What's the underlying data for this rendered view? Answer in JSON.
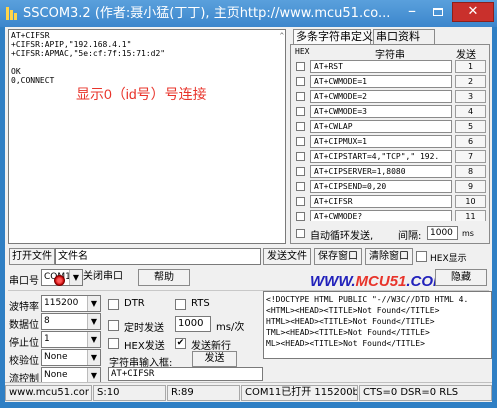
{
  "window": {
    "title": "SSCOM3.2 (作者:聂小猛(丁丁), 主页http://www.mcu51.co...",
    "minimize_label": "–",
    "close_label": "✕",
    "accent": "#3c86cc",
    "close_color": "#c9302c"
  },
  "receive": {
    "lines": [
      "AT+CIFSR",
      "+CIFSR:APIP,\"192.168.4.1\"",
      "+CIFSR:APMAC,\"5e:cf:7f:15:71:d2\"",
      "",
      "OK",
      "0,CONNECT"
    ],
    "annotation": "显示0（id号）号连接",
    "annotation_color": "#e8342b"
  },
  "multi": {
    "tab1": "多条字符串定义",
    "tab2": "串口资料",
    "col_hex": "HEX",
    "col_str": "字符串",
    "col_send": "发送",
    "rows": [
      {
        "cmd": "AT+RST",
        "send": "1"
      },
      {
        "cmd": "AT+CWMODE=1",
        "send": "2"
      },
      {
        "cmd": "AT+CWMODE=2",
        "send": "3"
      },
      {
        "cmd": "AT+CWMODE=3",
        "send": "4"
      },
      {
        "cmd": "AT+CWLAP",
        "send": "5"
      },
      {
        "cmd": "AT+CIPMUX=1",
        "send": "6"
      },
      {
        "cmd": " AT+CIPSTART=4,\"TCP\",\" 192.",
        "send": "7"
      },
      {
        "cmd": "AT+CIPSERVER=1,8080",
        "send": "8"
      },
      {
        "cmd": "AT+CIPSEND=0,20",
        "send": "9"
      },
      {
        "cmd": "AT+CIFSR",
        "send": "10"
      },
      {
        "cmd": "AT+CWMODE?",
        "send": "11"
      }
    ],
    "loop_label": "自动循环发送,",
    "interval_label": "间隔:",
    "interval_value": "1000",
    "interval_unit": "ms"
  },
  "row1": {
    "open_file": "打开文件",
    "file_name": "文件名",
    "send_file": "发送文件",
    "save_window": "保存窗口",
    "clear_window": "清除窗口",
    "hex_display": "HEX显示"
  },
  "row2": {
    "port_label": "串口号",
    "port_value": "COM11",
    "close_port": "关闭串口",
    "help": "帮助",
    "brand_a": "WWW.",
    "brand_b": "MCU51",
    "brand_c": ".COM",
    "hide": "隐藏"
  },
  "settings": {
    "baud_label": "波特率",
    "baud_value": "115200",
    "data_label": "数据位",
    "data_value": "8",
    "stop_label": "停止位",
    "stop_value": "1",
    "parity_label": "校验位",
    "parity_value": "None",
    "flow_label": "流控制",
    "flow_value": "None",
    "dtr": "DTR",
    "rts": "RTS",
    "timed_send": "定时发送",
    "timed_value": "1000",
    "timed_unit": "ms/次",
    "hex_send": "HEX发送",
    "send_newline": "发送新行",
    "input_label": "字符串输入框:",
    "send_button": "发送",
    "input_value": "AT+CIFSR"
  },
  "sendbox": {
    "lines": [
      "<!DOCTYPE HTML PUBLIC \"-//W3C//DTD HTML 4.",
      "<HTML><HEAD><TITLE>Not Found</TITLE>",
      "HTML><HEAD><TITLE>Not Found</TITLE>",
      "TML><HEAD><TITLE>Not Found</TITLE>",
      "ML><HEAD><TITLE>Not Found</TITLE>"
    ]
  },
  "status": {
    "site": "www.mcu51.cor",
    "s": "S:10",
    "r": "R:89",
    "port": "COM11已打开  115200bps",
    "lines": "CTS=0 DSR=0 RLS"
  }
}
